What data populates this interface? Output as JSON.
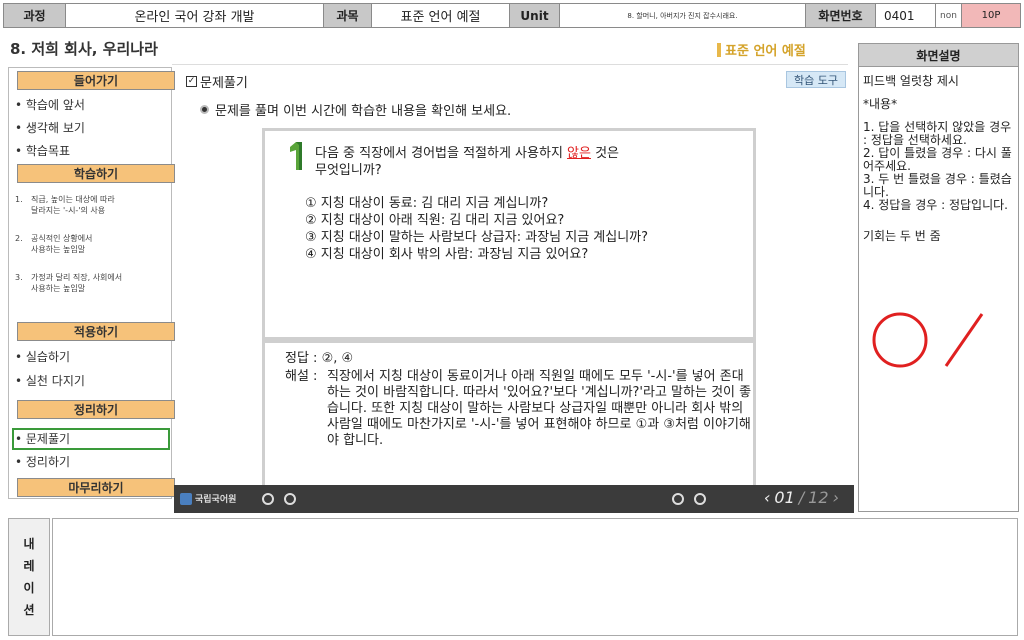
{
  "header": {
    "course_key": "과정",
    "course_value": "온라인 국어 강좌 개발",
    "subject_key": "과목",
    "subject_value": "표준 언어 예절",
    "unit_key": "Unit",
    "unit_value": "8. 할머니, 아버지가 진지 잡수시래요.",
    "screen_key": "화면번호",
    "screen_value": "0401",
    "non": "non",
    "page": "10P"
  },
  "lesson": {
    "title": "8. 저희 회사, 우리나라",
    "tag": "표준 언어 예절"
  },
  "nav": {
    "sections": [
      {
        "label": "들어가기"
      },
      {
        "label": "학습하기"
      },
      {
        "label": "적용하기"
      },
      {
        "label": "정리하기"
      },
      {
        "label": "마무리하기"
      }
    ],
    "intro_items": [
      "• 학습에 앞서",
      "• 생각해 보기",
      "• 학습목표"
    ],
    "study_items": [
      {
        "num": "1.",
        "text": "직급, 높이는 대상에 따라\n달라지는 '-시-'의 사용"
      },
      {
        "num": "2.",
        "text": "공식적인 상황에서\n사용하는 높임말"
      },
      {
        "num": "3.",
        "text": "가정과 달리 직장, 사회에서\n사용하는 높임말"
      }
    ],
    "apply_items": [
      "• 실습하기",
      "• 실천 다지기"
    ],
    "summary_items": [
      "• 문제풀기",
      "• 정리하기"
    ]
  },
  "content": {
    "section_label": "문제풀기",
    "tool_button": "학습 도구",
    "instruction": "문제를 풀며 이번 시간에 학습한 내용을 확인해 보세요.",
    "question": {
      "number": "1",
      "text_before": "다음 중 직장에서 경어법을 적절하게 사용하지 ",
      "text_emph": "않은",
      "text_after": " 것은\n무엇입니까?",
      "options": [
        "① 지칭 대상이 동료: 김 대리 지금 계십니까?",
        "② 지칭 대상이 아래 직원: 김 대리 지금 있어요?",
        "③ 지칭 대상이 말하는 사람보다 상급자: 과장님 지금 계십니까?",
        "④ 지칭 대상이 회사 밖의 사람: 과장님 지금 있어요?"
      ]
    },
    "answer_label": "정답 : ",
    "answer_value": "②, ④",
    "explanation_label": "해설 : ",
    "explanation": "직장에서 지칭 대상이 동료이거나 아래 직원일 때에도 모두 '-시-'를 넣어 존대하는 것이 바람직합니다. 따라서 '있어요?'보다 '계십니까?'라고 말하는 것이 좋습니다. 또한 지칭 대상이 말하는 사람보다 상급자일 때뿐만 아니라 회사 밖의 사람일 때에도 마찬가지로 '-시-'를 넣어 표현해야 하므로 ①과 ③처럼 이야기해야 합니다."
  },
  "player": {
    "logo_text": "국립국어원",
    "current_page": "01",
    "separator": "/",
    "total_pages": "12"
  },
  "desc": {
    "header": "화면설명",
    "line1": "피드백 얼럿창 제시",
    "line2": "*내용*",
    "list": [
      "1. 답을 선택하지 않았을 경우 : 정답을 선택하세요.",
      "2. 답이 틀렸을 경우 : 다시 풀어주세요.",
      "3. 두 번 틀렸을 경우 : 틀렸습니다.",
      "4. 정답을 경우 : 정답입니다."
    ],
    "chances": "기회는 두 번 줌"
  },
  "narration": {
    "label": "내레이션"
  },
  "colors": {
    "section_button": "#f6c27a",
    "active_border": "#3a9a3a",
    "emphasis_red": "#e02020",
    "mark_red": "#e02020",
    "tag_gold": "#d4a32a"
  }
}
